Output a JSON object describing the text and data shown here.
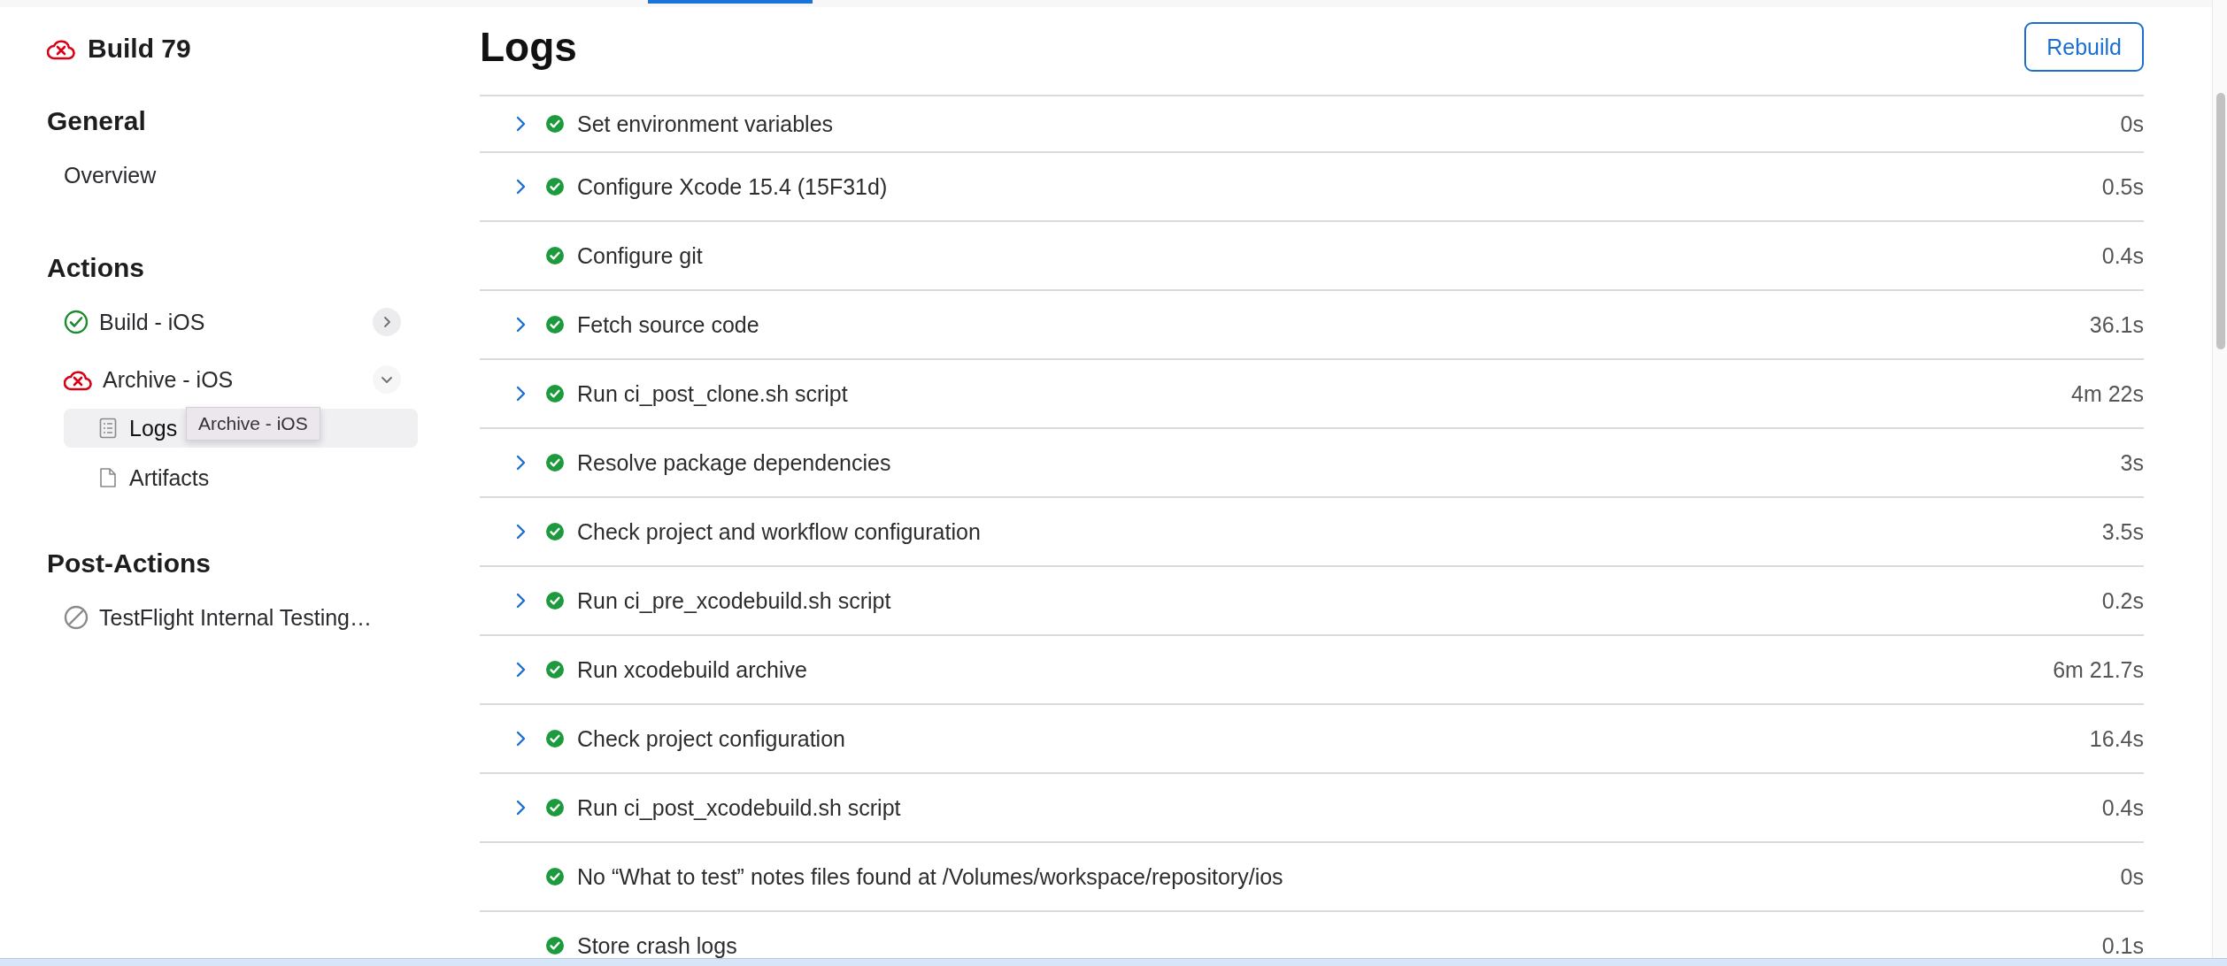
{
  "sidebar": {
    "build_title": "Build 79",
    "build_failed": true,
    "sections": [
      {
        "title": "General",
        "items": [
          {
            "label": "Overview",
            "kind": "link",
            "selected": false
          }
        ]
      },
      {
        "title": "Actions",
        "items": [
          {
            "label": "Build - iOS",
            "kind": "action",
            "failed": false,
            "skipped": false,
            "expanded": false,
            "selected": false
          },
          {
            "label": "Archive - iOS",
            "kind": "action",
            "failed": true,
            "expanded": true,
            "selected": false,
            "children": [
              {
                "label": "Logs",
                "kind": "logs",
                "selected": true
              },
              {
                "label": "Artifacts",
                "kind": "file",
                "selected": false
              }
            ]
          }
        ]
      },
      {
        "title": "Post-Actions",
        "items": [
          {
            "label": "TestFlight Internal Testing…",
            "kind": "action",
            "failed": false,
            "skipped": true,
            "selected": false
          }
        ]
      }
    ]
  },
  "tooltip": {
    "text": "Archive - iOS"
  },
  "main": {
    "title": "Logs",
    "rebuild_button": "Rebuild",
    "steps": [
      {
        "name": "Set environment variables",
        "duration": "0s",
        "expandable": true,
        "failed": false
      },
      {
        "name": "Configure Xcode 15.4 (15F31d)",
        "duration": "0.5s",
        "expandable": true,
        "failed": false
      },
      {
        "name": "Configure git",
        "duration": "0.4s",
        "expandable": false,
        "failed": false
      },
      {
        "name": "Fetch source code",
        "duration": "36.1s",
        "expandable": true,
        "failed": false
      },
      {
        "name": "Run ci_post_clone.sh script",
        "duration": "4m 22s",
        "expandable": true,
        "failed": false
      },
      {
        "name": "Resolve package dependencies",
        "duration": "3s",
        "expandable": true,
        "failed": false
      },
      {
        "name": "Check project and workflow configuration",
        "duration": "3.5s",
        "expandable": true,
        "failed": false
      },
      {
        "name": "Run ci_pre_xcodebuild.sh script",
        "duration": "0.2s",
        "expandable": true,
        "failed": false
      },
      {
        "name": "Run xcodebuild archive",
        "duration": "6m 21.7s",
        "expandable": true,
        "failed": false
      },
      {
        "name": "Check project configuration",
        "duration": "16.4s",
        "expandable": true,
        "failed": false
      },
      {
        "name": "Run ci_post_xcodebuild.sh script",
        "duration": "0.4s",
        "expandable": true,
        "failed": false
      },
      {
        "name": "No “What to test” notes files found at /Volumes/workspace/repository/ios",
        "duration": "0s",
        "expandable": false,
        "failed": false
      },
      {
        "name": "Store crash logs",
        "duration": "0.1s",
        "expandable": false,
        "failed": false
      }
    ]
  }
}
